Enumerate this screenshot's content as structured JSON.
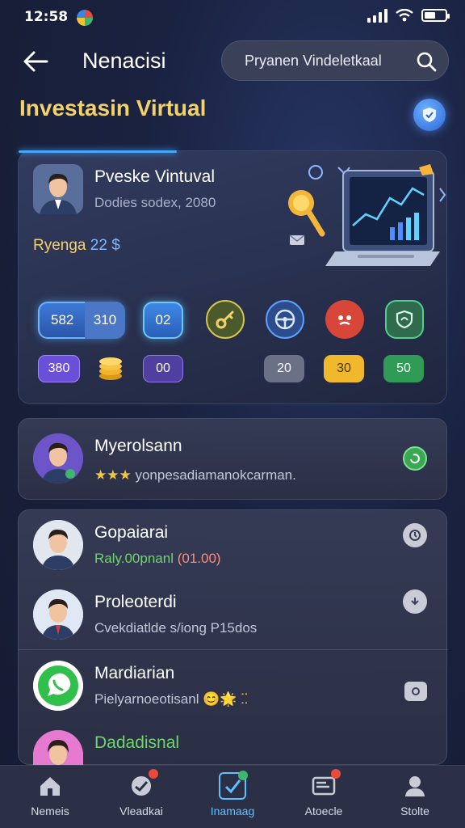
{
  "status_bar": {
    "time": "12:58"
  },
  "top_nav": {
    "title": "Nenacisi",
    "search_placeholder": "Pryanen Vindeletkaal"
  },
  "section_title": "Investasin Virtual",
  "hero": {
    "name": "Pveske Vintuval",
    "subtitle": "Dodies sodex, 2080",
    "balance_label": "Ryenga",
    "balance_value": "22 $",
    "chips_row1": [
      "582",
      "310",
      "02"
    ],
    "chips_row2": [
      "380",
      "00",
      "20",
      "30",
      "50"
    ],
    "icons": [
      "key-icon",
      "steering-wheel-icon",
      "angry-face-icon",
      "shield-leaf-icon"
    ]
  },
  "list_items": [
    {
      "title": "Myerolsann",
      "subtitle": "yonpesadiamanokcarman.",
      "stars": "★★★",
      "action_icon": "refresh-icon"
    },
    {
      "title": "Gopaiarai",
      "subtitle_green": "Raly.00pnanl",
      "subtitle_red": "(01.00)",
      "action_icon": "clock-icon"
    },
    {
      "title": "Proleoterdi",
      "subtitle": "Cvekdiatlde s/iong P15dos",
      "action_icon": "download-icon"
    },
    {
      "title": "Mardiarian",
      "subtitle": "Pielyarnoeotisanl",
      "emoji": "😊🌟 ⵆ",
      "action_icon": "camera-icon"
    },
    {
      "title": "Dadadisnal"
    }
  ],
  "bottom_nav": [
    {
      "label": "Nemeis",
      "icon": "home-icon"
    },
    {
      "label": "Vleadkai",
      "icon": "activity-icon"
    },
    {
      "label": "Inamaag",
      "icon": "checklist-icon",
      "active": true
    },
    {
      "label": "Atoecle",
      "icon": "inbox-icon"
    },
    {
      "label": "Stolte",
      "icon": "profile-icon"
    }
  ],
  "colors": {
    "accent": "#45a8ff",
    "gold": "#f3d26b",
    "background": "#161b31"
  }
}
